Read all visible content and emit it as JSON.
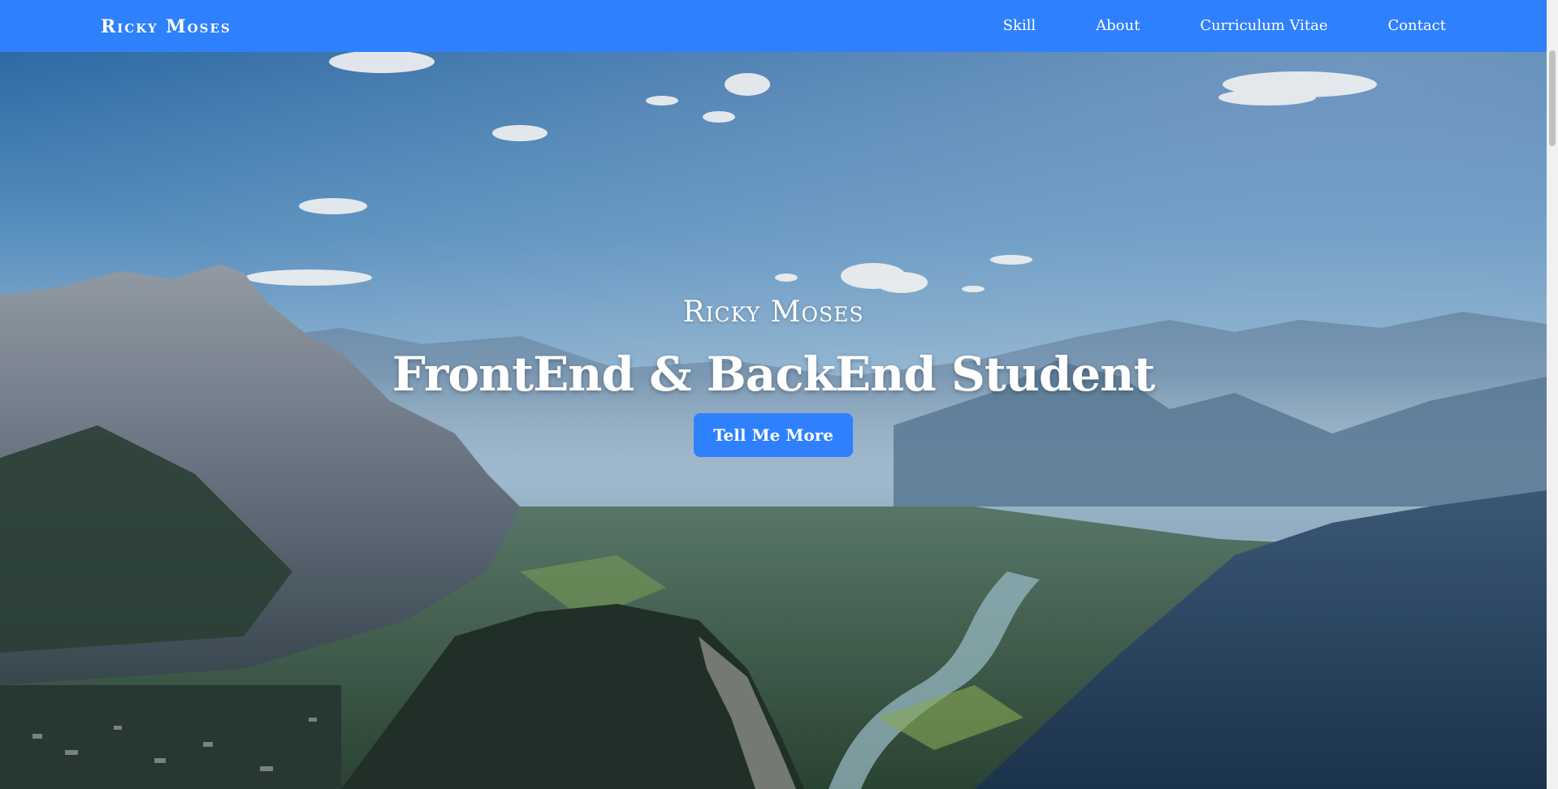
{
  "navbar": {
    "brand": "Ricky Moses",
    "links": [
      {
        "label": "Skill"
      },
      {
        "label": "About"
      },
      {
        "label": "Curriculum Vitae"
      },
      {
        "label": "Contact"
      }
    ]
  },
  "hero": {
    "subtitle": "Ricky Moses",
    "heading": "FrontEnd & BackEnd Student",
    "button_label": "Tell Me More",
    "background_image": "mountain-valley-landscape"
  },
  "colors": {
    "accent": "#2f80fd",
    "text_light": "#ffffff"
  }
}
